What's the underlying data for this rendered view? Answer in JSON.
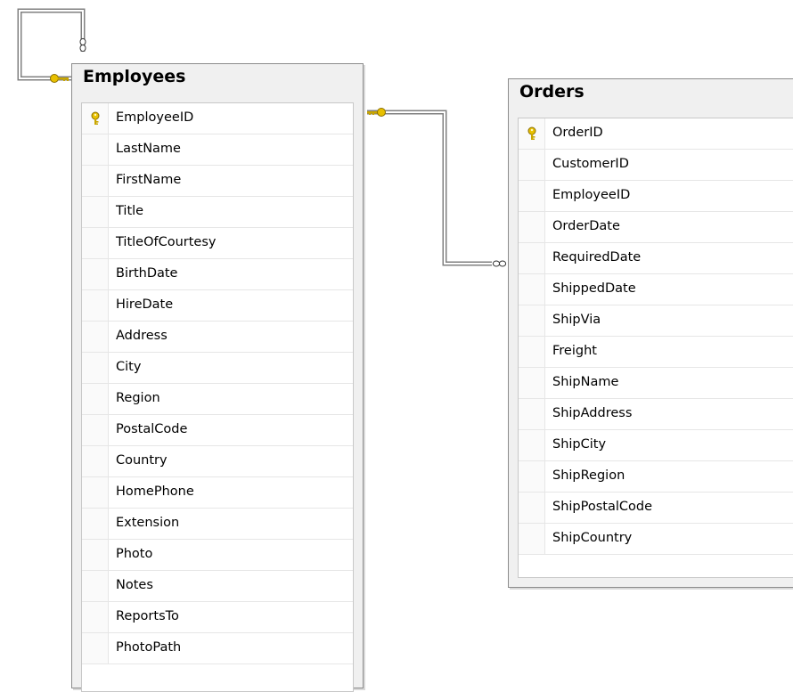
{
  "tables": [
    {
      "name": "Employees",
      "columns": [
        {
          "name": "EmployeeID",
          "primary_key": true
        },
        {
          "name": "LastName"
        },
        {
          "name": "FirstName"
        },
        {
          "name": "Title"
        },
        {
          "name": "TitleOfCourtesy"
        },
        {
          "name": "BirthDate"
        },
        {
          "name": "HireDate"
        },
        {
          "name": "Address"
        },
        {
          "name": "City"
        },
        {
          "name": "Region"
        },
        {
          "name": "PostalCode"
        },
        {
          "name": "Country"
        },
        {
          "name": "HomePhone"
        },
        {
          "name": "Extension"
        },
        {
          "name": "Photo"
        },
        {
          "name": "Notes"
        },
        {
          "name": "ReportsTo"
        },
        {
          "name": "PhotoPath"
        }
      ]
    },
    {
      "name": "Orders",
      "columns": [
        {
          "name": "OrderID",
          "primary_key": true
        },
        {
          "name": "CustomerID"
        },
        {
          "name": "EmployeeID"
        },
        {
          "name": "OrderDate"
        },
        {
          "name": "RequiredDate"
        },
        {
          "name": "ShippedDate"
        },
        {
          "name": "ShipVia"
        },
        {
          "name": "Freight"
        },
        {
          "name": "ShipName"
        },
        {
          "name": "ShipAddress"
        },
        {
          "name": "ShipCity"
        },
        {
          "name": "ShipRegion"
        },
        {
          "name": "ShipPostalCode"
        },
        {
          "name": "ShipCountry"
        }
      ]
    }
  ],
  "relationships": [
    {
      "from": "Employees",
      "to": "Employees",
      "one_end": "key",
      "many_end": "infinity"
    },
    {
      "from": "Employees",
      "to": "Orders",
      "one_end": "key",
      "many_end": "infinity"
    }
  ],
  "colors": {
    "key_icon": "#e8c000",
    "line": "#808080",
    "table_bg": "#f0f0f0"
  }
}
